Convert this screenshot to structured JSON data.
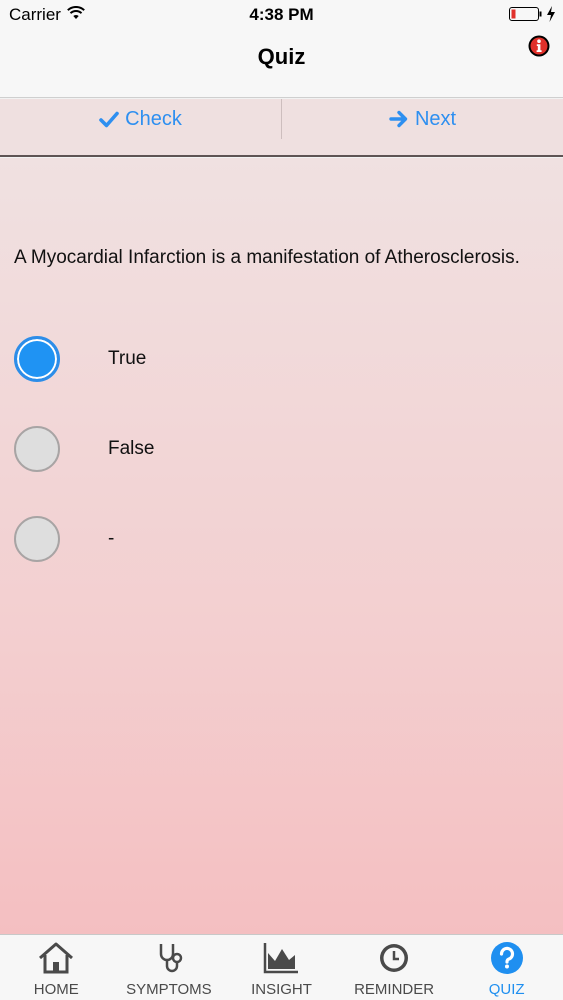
{
  "status": {
    "carrier": "Carrier",
    "time": "4:38 PM",
    "icons": [
      "wifi-icon",
      "battery-icon",
      "charging-bolt-icon"
    ]
  },
  "nav": {
    "title": "Quiz",
    "info_icon": "info-icon"
  },
  "actions": {
    "check_label": "Check",
    "check_icon": "checkmark-icon",
    "next_label": "Next",
    "next_icon": "arrow-right-icon"
  },
  "question": {
    "text": "A Myocardial Infarction is a manifestation of Atherosclerosis.",
    "options": [
      {
        "label": "True",
        "selected": true
      },
      {
        "label": "False",
        "selected": false
      },
      {
        "label": "-",
        "selected": false
      }
    ]
  },
  "tabs": [
    {
      "label": "HOME",
      "icon": "home-icon",
      "active": false
    },
    {
      "label": "SYMPTOMS",
      "icon": "stethoscope-icon",
      "active": false
    },
    {
      "label": "INSIGHT",
      "icon": "area-chart-icon",
      "active": false
    },
    {
      "label": "REMINDER",
      "icon": "clock-icon",
      "active": false
    },
    {
      "label": "QUIZ",
      "icon": "question-icon",
      "active": true
    }
  ],
  "colors": {
    "accent": "#1f8ff0",
    "battery_low": "#e0302a",
    "background_top": "#f0e1e1",
    "background_bottom": "#f4bfc1"
  }
}
